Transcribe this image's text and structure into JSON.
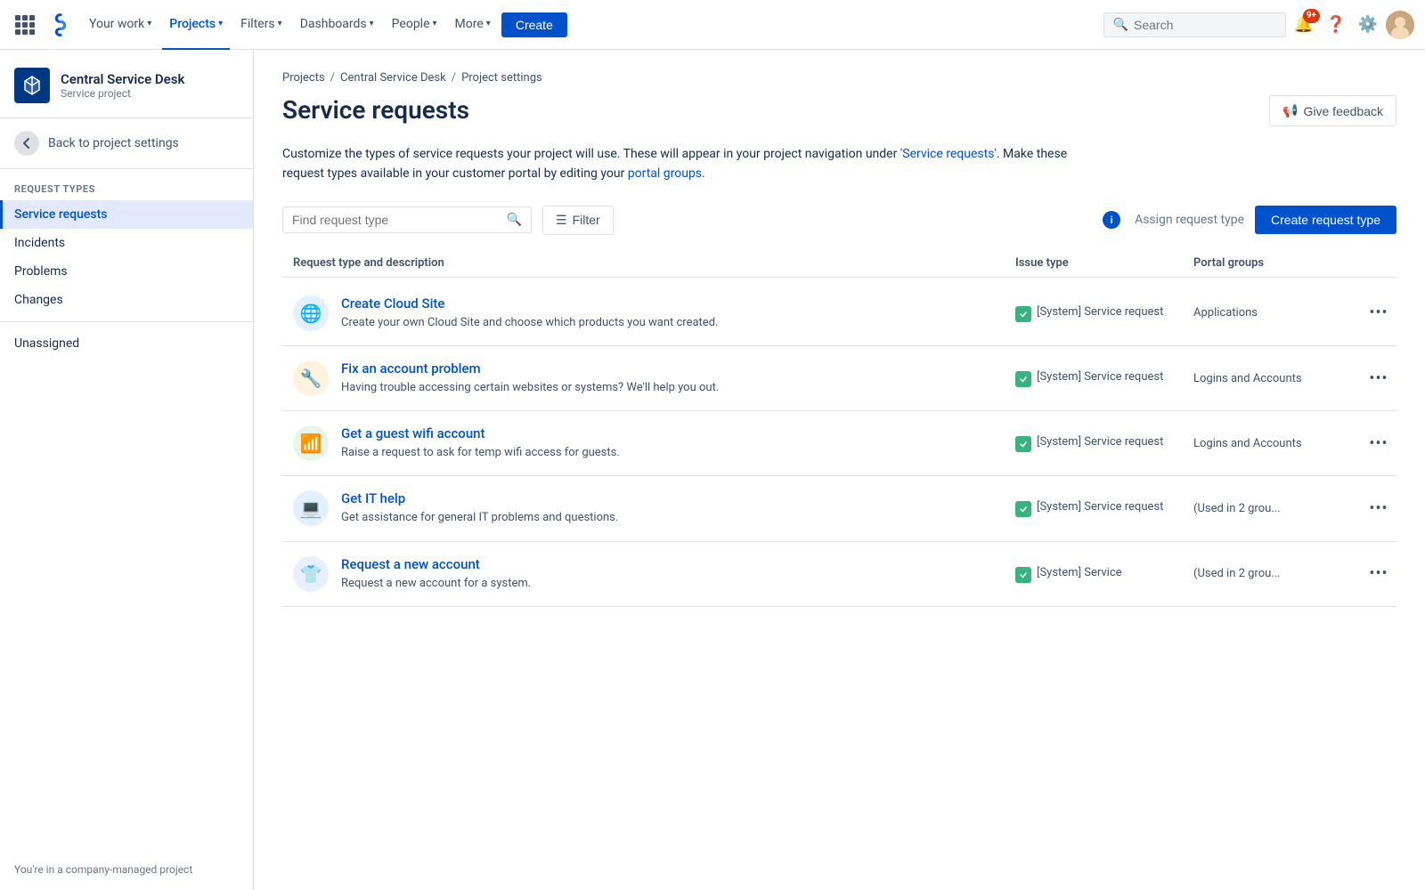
{
  "topnav": {
    "your_work": "Your work",
    "projects": "Projects",
    "filters": "Filters",
    "dashboards": "Dashboards",
    "people": "People",
    "more": "More",
    "create": "Create",
    "search_placeholder": "Search",
    "notif_count": "9+"
  },
  "sidebar": {
    "project_name": "Central Service Desk",
    "project_type": "Service project",
    "back_label": "Back to project settings",
    "section_label": "REQUEST TYPES",
    "nav_items": [
      {
        "label": "Service requests",
        "active": true
      },
      {
        "label": "Incidents",
        "active": false
      },
      {
        "label": "Problems",
        "active": false
      },
      {
        "label": "Changes",
        "active": false
      },
      {
        "label": "Unassigned",
        "active": false
      }
    ],
    "footer": "You're in a company-managed project"
  },
  "breadcrumb": {
    "items": [
      "Projects",
      "Central Service Desk",
      "Project settings"
    ]
  },
  "page": {
    "title": "Service requests",
    "feedback_btn": "Give feedback",
    "description_part1": "Customize the types of service requests your project will use. These will appear in your project navigation under ",
    "description_link1": "'Service requests'",
    "description_part2": ". Make these request types available in your customer portal by editing your ",
    "description_link2": "portal groups",
    "description_part3": "."
  },
  "toolbar": {
    "search_placeholder": "Find request type",
    "filter_label": "Filter",
    "assign_label": "Assign request type",
    "create_label": "Create request type"
  },
  "table": {
    "col1": "Request type and description",
    "col2": "Issue type",
    "col3": "Portal groups",
    "rows": [
      {
        "icon": "🌐",
        "icon_bg": "#e3f0ff",
        "title": "Create Cloud Site",
        "desc": "Create your own Cloud Site and choose which products you want created.",
        "issue_type": "[System] Service request",
        "portal_groups": "Applications"
      },
      {
        "icon": "🔧",
        "icon_bg": "#fff3e0",
        "title": "Fix an account problem",
        "desc": "Having trouble accessing certain websites or systems? We'll help you out.",
        "issue_type": "[System] Service request",
        "portal_groups": "Logins and Accounts"
      },
      {
        "icon": "📶",
        "icon_bg": "#e8f5e9",
        "title": "Get a guest wifi account",
        "desc": "Raise a request to ask for temp wifi access for guests.",
        "issue_type": "[System] Service request",
        "portal_groups": "Logins and Accounts"
      },
      {
        "icon": "💻",
        "icon_bg": "#e3f0ff",
        "title": "Get IT help",
        "desc": "Get assistance for general IT problems and questions.",
        "issue_type": "[System] Service request",
        "portal_groups": "(Used in 2 grou..."
      },
      {
        "icon": "👕",
        "icon_bg": "#e8f0ff",
        "title": "Request a new account",
        "desc": "Request a new account for a system.",
        "issue_type": "[System] Service",
        "portal_groups": "(Used in 2 grou..."
      }
    ]
  }
}
